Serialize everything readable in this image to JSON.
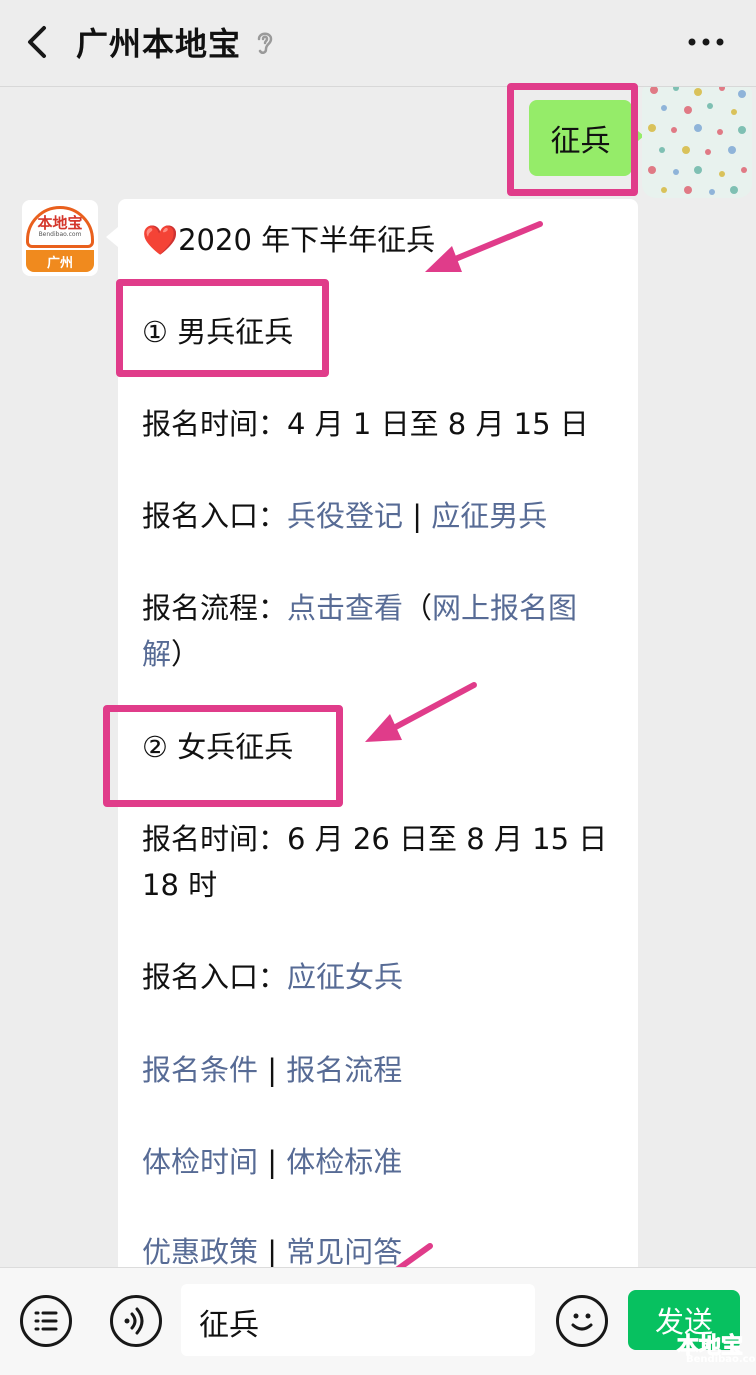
{
  "header": {
    "title": "广州本地宝",
    "back_icon": "chevron-left-icon",
    "ear_icon": "ear-icon",
    "more_icon": "more-icon"
  },
  "messages": {
    "sent_text": "征兵",
    "bot_logo": {
      "name": "本地宝",
      "site": "Bendibao.com",
      "city": "广州"
    },
    "reply": {
      "heading": "❤️2020 年下半年征兵",
      "section1_title": "① 男兵征兵",
      "s1_time_label": "报名时间：",
      "s1_time_value": "4 月 1 日至 8 月 15 日",
      "s1_entry_label": "报名入口：",
      "s1_entry_link1": "兵役登记",
      "s1_entry_link2": "应征男兵",
      "s1_flow_label": "报名流程：",
      "s1_flow_link1": "点击查看",
      "s1_flow_paren_open": "（",
      "s1_flow_link2a": "网上报名图",
      "s1_flow_link2b": "解",
      "s1_flow_paren_close": "）",
      "section2_title": "② 女兵征兵",
      "s2_time_label": "报名时间：",
      "s2_time_value_line1": "6 月 26 日至 8 月 15 日",
      "s2_time_value_line2": "18 时",
      "s2_entry_label": "报名入口：",
      "s2_entry_link": "应征女兵",
      "link_row1_a": "报名条件",
      "link_row1_b": "报名流程",
      "link_row2_a": "体检时间",
      "link_row2_b": "体检标准",
      "link_row3_a": "优惠政策",
      "link_row3_b": "常见问答",
      "separator": " | "
    }
  },
  "input_bar": {
    "menu_icon": "menu-list-icon",
    "voice_icon": "voice-icon",
    "input_value": "征兵",
    "emoji_icon": "emoji-icon",
    "send_label": "发送"
  },
  "watermark": {
    "text": "本地宝",
    "sub": "Bendibao.com"
  },
  "colors": {
    "link": "#576b95",
    "highlight": "#e03c8a",
    "sent_bubble": "#95ec69",
    "send_button": "#07c160"
  }
}
